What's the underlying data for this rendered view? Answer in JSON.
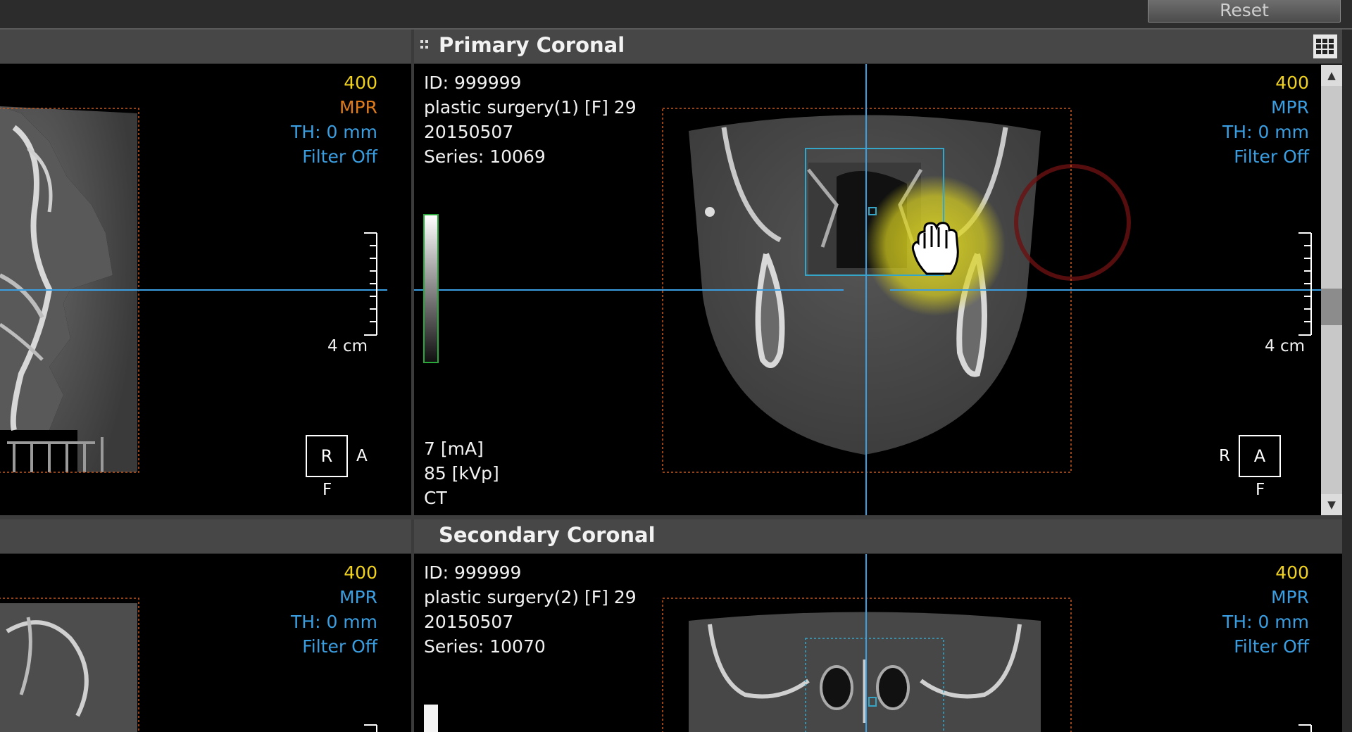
{
  "toolbar": {
    "reset_label": "Reset"
  },
  "panels": {
    "primary": {
      "title": "Primary Coronal",
      "id_line": "ID: 999999",
      "patient": "plastic surgery(1) [F] 29",
      "date": "20150507",
      "series": "Series: 10069",
      "ma": "7 [mA]",
      "kvp": "85 [kVp]",
      "modality": "CT",
      "wl": "400",
      "mode": "MPR",
      "th": "TH: 0 mm",
      "filter": "Filter Off",
      "scale": "4 cm",
      "orient": {
        "left": "R",
        "box": "A",
        "bottom": "F"
      }
    },
    "left_top": {
      "wl": "400",
      "mode": "MPR",
      "th": "TH: 0 mm",
      "filter": "Filter Off",
      "scale": "4 cm",
      "orient": {
        "box": "R",
        "right": "A",
        "bottom": "F"
      }
    },
    "secondary": {
      "title": "Secondary Coronal",
      "id_line": "ID: 999999",
      "patient": "plastic surgery(2) [F] 29",
      "date": "20150507",
      "series": "Series: 10070",
      "wl": "400",
      "mode": "MPR",
      "th": "TH: 0 mm",
      "filter": "Filter Off"
    },
    "left_bottom": {
      "wl": "400",
      "mode": "MPR",
      "th": "TH: 0 mm",
      "filter": "Filter Off"
    }
  },
  "icons": {
    "drag_handle": "drag-handle-icon",
    "layout_grid": "layout-grid-icon",
    "hand_cursor": "hand-cursor-icon"
  },
  "colors": {
    "crosshair": "#3a9ee0",
    "wl_text": "#f0d21f",
    "mode_active": "#e07b1a",
    "overlay_info": "#3a9ee0",
    "bounding": "#d0621a",
    "roi": "#36a6c8",
    "highlight": "#f0e020"
  }
}
